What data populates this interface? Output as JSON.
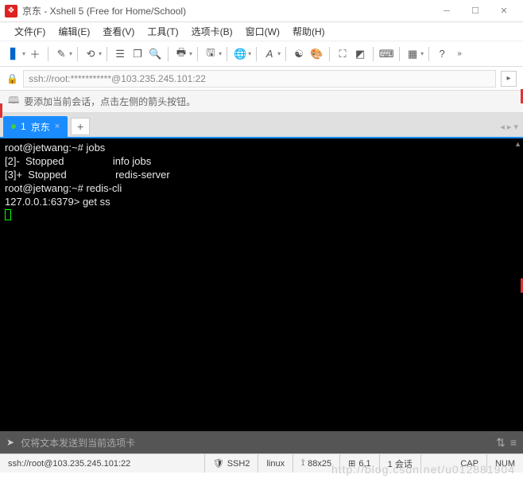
{
  "title": "京东 - Xshell 5 (Free for Home/School)",
  "menus": {
    "file": "文件(F)",
    "edit": "编辑(E)",
    "view": "查看(V)",
    "tool": "工具(T)",
    "tab": "选项卡(B)",
    "window": "窗口(W)",
    "help": "帮助(H)"
  },
  "address": "ssh://root:***********@103.235.245.101:22",
  "hint": "要添加当前会话，点击左侧的箭头按钮。",
  "tab": {
    "index": "1",
    "name": "京东"
  },
  "terminal": {
    "l1": "root@jetwang:~# jobs",
    "l2": "[2]-  Stopped                 info jobs",
    "l3": "[3]+  Stopped                 redis-server",
    "l4": "root@jetwang:~# redis-cli",
    "l5": "127.0.0.1:6379> get ss"
  },
  "input_placeholder": "仅将文本发送到当前选项卡",
  "status": {
    "conn": "ssh://root@103.235.245.101:22",
    "proto": "SSH2",
    "os": "linux",
    "size": "88x25",
    "pos": "6,1",
    "sessions": "1 会话",
    "caps": "CAP",
    "num": "NUM"
  },
  "watermark": "http://blog.csdn.net/u012881904"
}
